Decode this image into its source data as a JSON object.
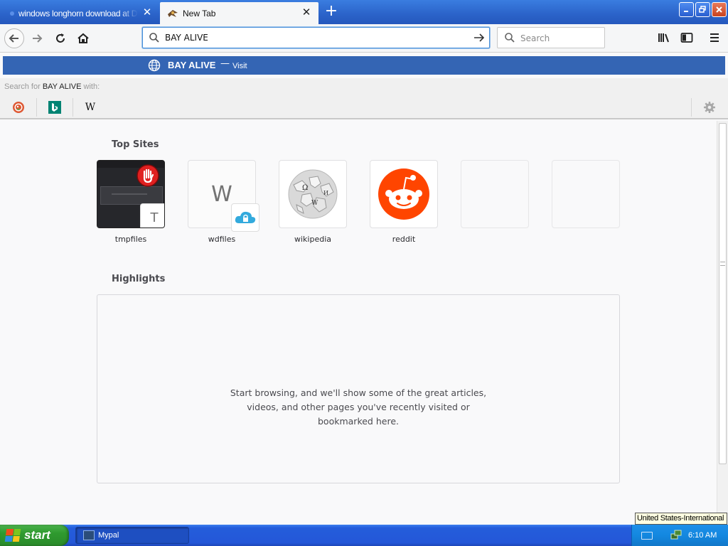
{
  "browser": {
    "tabs": [
      {
        "label": "windows longhorn download at Du",
        "active": false
      },
      {
        "label": "New Tab",
        "active": true
      }
    ],
    "url_value": "BAY ALIVE",
    "search_placeholder": "Search"
  },
  "suggestion": {
    "title": "BAY ALIVE",
    "separator": "—",
    "action": "Visit"
  },
  "search_with": {
    "prefix": "Search for ",
    "query": "BAY ALIVE",
    "suffix": " with:"
  },
  "engines": [
    {
      "name": "DuckDuckGo",
      "icon": "duckduckgo-icon"
    },
    {
      "name": "Bing",
      "icon": "bing-icon"
    },
    {
      "name": "Wikipedia",
      "icon": "wikipedia-icon",
      "glyph": "W"
    }
  ],
  "top_sites": {
    "heading": "Top Sites",
    "tiles": [
      {
        "label": "tmpfiles",
        "badge": "T"
      },
      {
        "label": "wdfiles",
        "letter": "W"
      },
      {
        "label": "wikipedia"
      },
      {
        "label": "reddit"
      }
    ]
  },
  "highlights": {
    "heading": "Highlights",
    "message_line1": "Start browsing, and we'll show some of the great articles,",
    "message_line2": "videos, and other pages you've recently visited or",
    "message_line3": "bookmarked here."
  },
  "taskbar": {
    "start_label": "start",
    "task_label": "Mypal",
    "language": "United States-International",
    "clock": "6:10 AM"
  },
  "colors": {
    "suggestion_bar": "#3465b4",
    "reddit": "#ff4500",
    "xp_blue": "#245ddb",
    "start_green": "#2f9a2f"
  }
}
